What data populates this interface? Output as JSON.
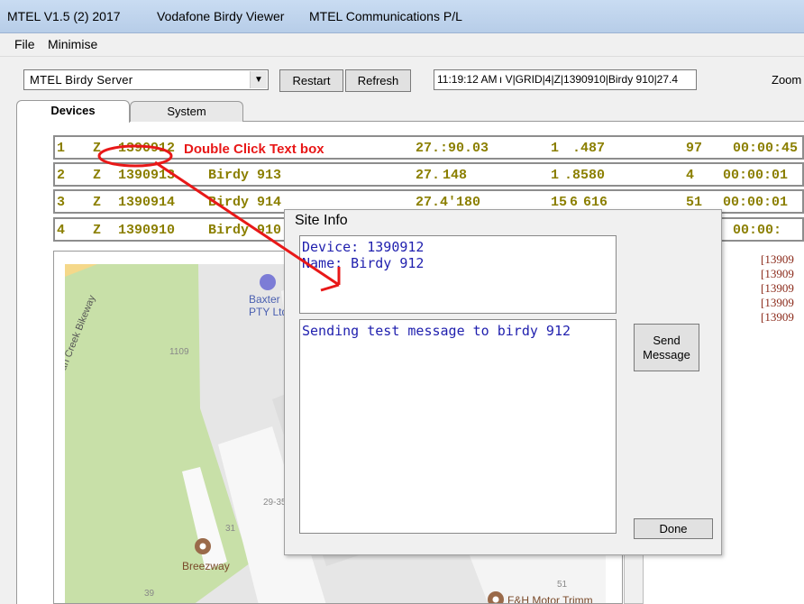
{
  "titlebar": {
    "app": "MTEL V1.5 (2)  2017",
    "viewer": "Vodafone Birdy Viewer",
    "company": "MTEL Communications P/L"
  },
  "menu": {
    "file": "File",
    "minimise": "Minimise"
  },
  "toolbar": {
    "server": "MTEL Birdy Server",
    "restart": "Restart",
    "refresh": "Refresh",
    "status": "11:19:12 AM ı V|GRID|4|Z|1390910|Birdy 910|27.4",
    "zoom": "Zoom"
  },
  "tabs": {
    "devices": "Devices",
    "system": "System"
  },
  "devices": [
    {
      "num": "1",
      "zone": "Z",
      "id": "1390912",
      "name": "",
      "lat": "27.:90.03",
      "lon": "1     .487",
      "val": "97",
      "time": "00:00:45"
    },
    {
      "num": "2",
      "zone": "Z",
      "id": "1390913",
      "name": "Birdy 913",
      "lat": "27. 148",
      "lon": "1  .8580",
      "val": "4",
      "time": "00:00:01"
    },
    {
      "num": "3",
      "zone": "Z",
      "id": "1390914",
      "name": "Birdy 914",
      "lat": "27.4'180",
      "lon": "15 6  616",
      "val": "51",
      "time": "00:00:01"
    },
    {
      "num": "4",
      "zone": "Z",
      "id": "1390910",
      "name": "Birdy 910",
      "lat": "",
      "lon": "",
      "val": "",
      "time": "00:00:"
    }
  ],
  "map": {
    "place1": "Baxter",
    "place1b": "PTY Ltd",
    "road": "Norman Creek Bikeway",
    "num1109": "1109",
    "num2935": "29-35",
    "num31": "31",
    "num39": "39",
    "num51": "51",
    "breezeway": "Breezway",
    "motor": "F&H Motor Trimm"
  },
  "logs": [
    "[13909",
    "[13909",
    "[13909",
    "[13909",
    "[13909"
  ],
  "dialog": {
    "title": "Site Info",
    "device_line": "Device: 1390912",
    "name_line": "Name: Birdy 912",
    "message": "Sending test message to birdy 912",
    "send": "Send\nMessage",
    "send1": "Send",
    "send2": "Message",
    "done": "Done"
  },
  "annotation": {
    "text": "Double Click Text box"
  }
}
